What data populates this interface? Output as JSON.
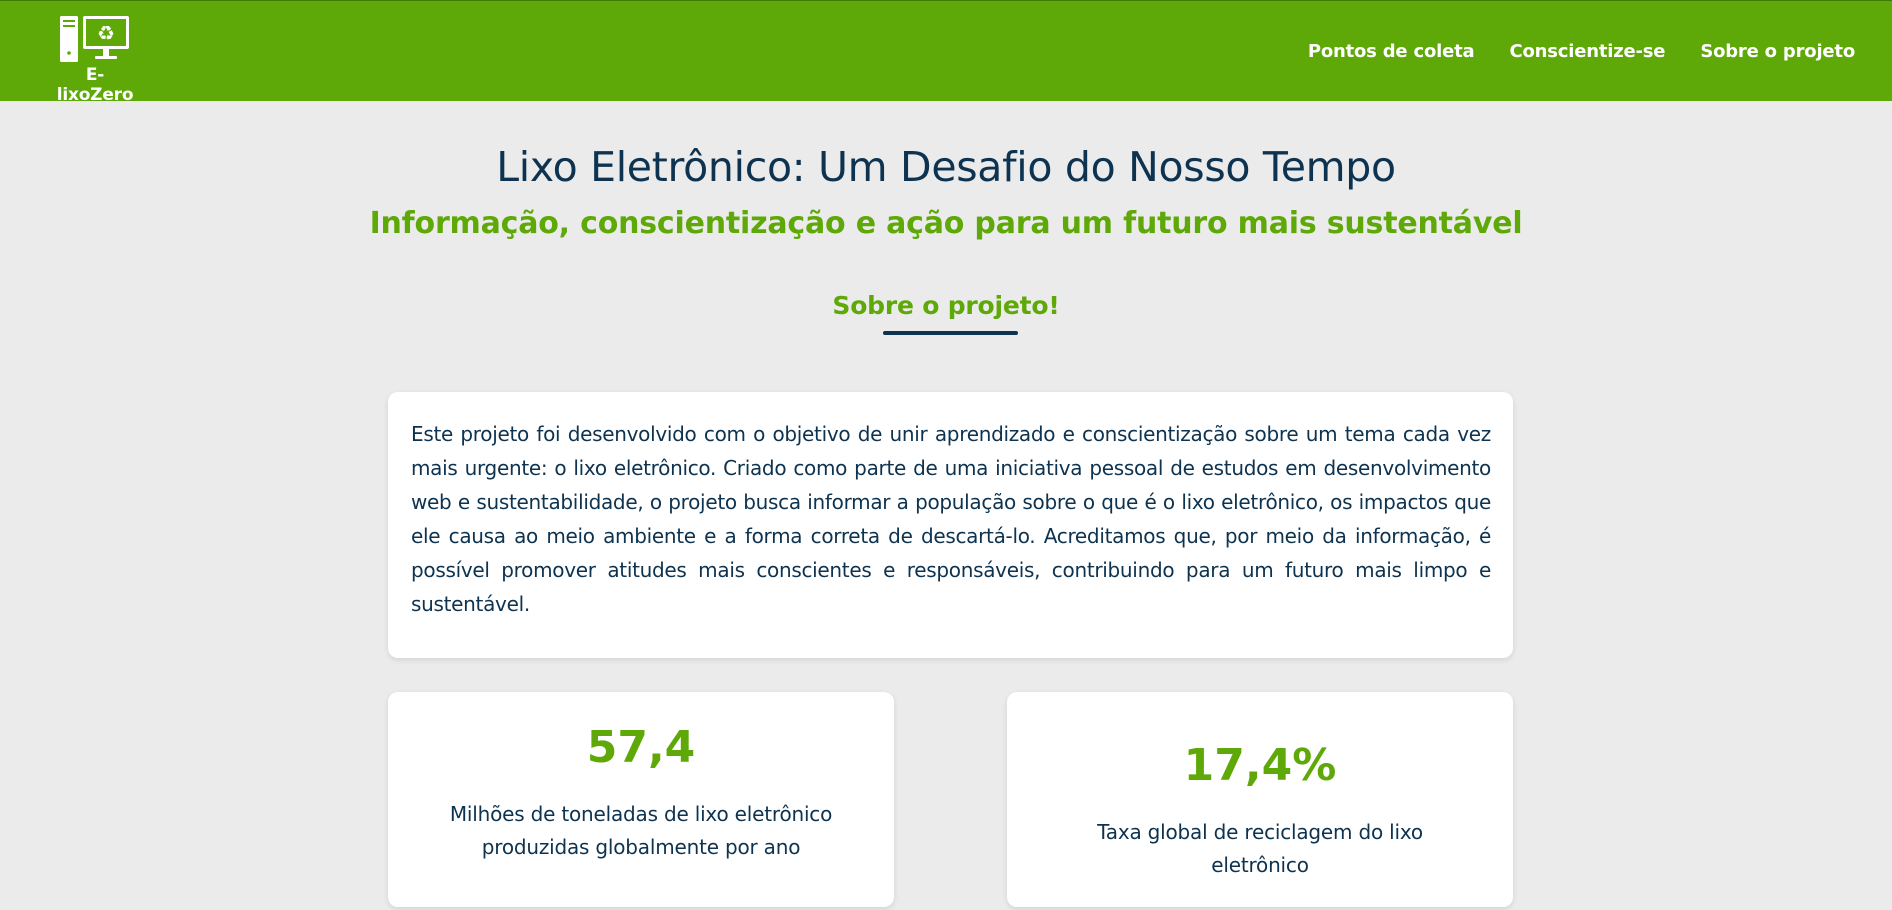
{
  "header": {
    "logo_text": "E-lixoZero",
    "logo_icon": "computer-recycle-icon",
    "nav": [
      {
        "label": "Pontos de coleta"
      },
      {
        "label": "Conscientize-se"
      },
      {
        "label": "Sobre o projeto"
      }
    ]
  },
  "hero": {
    "title": "Lixo Eletrônico: Um Desafio do Nosso Tempo",
    "subtitle": "Informação, conscientização e ação para um futuro mais sustentável"
  },
  "about": {
    "heading": "Sobre o projeto!",
    "text": "Este projeto foi desenvolvido com o objetivo de unir aprendizado e conscientização sobre um tema cada vez mais urgente: o lixo eletrônico. Criado como parte de uma iniciativa pessoal de estudos em desenvolvimento web e sustentabilidade, o projeto busca informar a população sobre o que é o lixo eletrônico, os impactos que ele causa ao meio ambiente e a forma correta de descartá-lo. Acreditamos que, por meio da informação, é possível promover atitudes mais conscientes e responsáveis, contribuindo para um futuro mais limpo e sustentável."
  },
  "stats": [
    {
      "value": "57,4",
      "label": "Milhões de toneladas de lixo eletrônico produzidas globalmente por ano"
    },
    {
      "value": "17,4%",
      "label": "Taxa global de reciclagem do lixo eletrônico"
    }
  ],
  "colors": {
    "header_bg": "#5ea808",
    "accent_green": "#5ea808",
    "navy": "#0d3350",
    "page_bg": "#ebebeb"
  }
}
